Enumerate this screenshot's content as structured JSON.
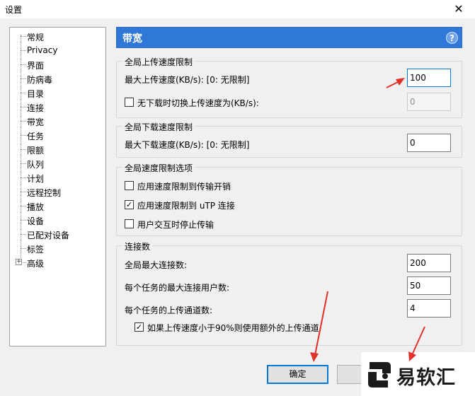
{
  "window": {
    "title": "设置",
    "close_glyph": "✕"
  },
  "tree": {
    "items": [
      {
        "label": "常规"
      },
      {
        "label": "Privacy"
      },
      {
        "label": "界面"
      },
      {
        "label": "防病毒"
      },
      {
        "label": "目录"
      },
      {
        "label": "连接"
      },
      {
        "label": "带宽"
      },
      {
        "label": "任务"
      },
      {
        "label": "限额"
      },
      {
        "label": "队列"
      },
      {
        "label": "计划"
      },
      {
        "label": "远程控制"
      },
      {
        "label": "播放"
      },
      {
        "label": "设备"
      },
      {
        "label": "已配对设备"
      },
      {
        "label": "标签"
      },
      {
        "label": "高级",
        "expander": "+"
      }
    ]
  },
  "header": {
    "title": "带宽",
    "help": "?"
  },
  "upload_group": {
    "title": "全局上传速度限制",
    "max_label": "最大上传速度(KB/s): [0: 无限制]",
    "max_value": "100",
    "alt_label": "无下载时切换上传速度为(KB/s):",
    "alt_checked": false,
    "alt_value": "0"
  },
  "download_group": {
    "title": "全局下载速度限制",
    "max_label": "最大下载速度(KB/s): [0: 无限制]",
    "max_value": "0"
  },
  "options_group": {
    "title": "全局速度限制选项",
    "options": [
      {
        "label": "应用速度限制到传输开销",
        "checked": false
      },
      {
        "label": "应用速度限制到 uTP 连接",
        "checked": true
      },
      {
        "label": "用户交互时停止传输",
        "checked": false
      }
    ]
  },
  "connections_group": {
    "title": "连接数",
    "global_max_label": "全局最大连接数:",
    "global_max_value": "200",
    "per_task_peers_label": "每个任务的最大连接用户数:",
    "per_task_peers_value": "50",
    "upload_slots_label": "每个任务的上传通道数:",
    "upload_slots_value": "4",
    "extra_slots_label": "如果上传速度小于90%则使用额外的上传通道",
    "extra_slots_checked": true
  },
  "buttons": {
    "ok": "确定"
  },
  "watermark": {
    "text": "易软汇"
  },
  "icons": {
    "help": "help-icon",
    "close": "close-icon",
    "check": "check-icon",
    "expand": "plus-box-icon"
  },
  "colors": {
    "header_bg": "#3078d8",
    "arrow": "#e0312a",
    "focus_border": "#0078d7"
  }
}
